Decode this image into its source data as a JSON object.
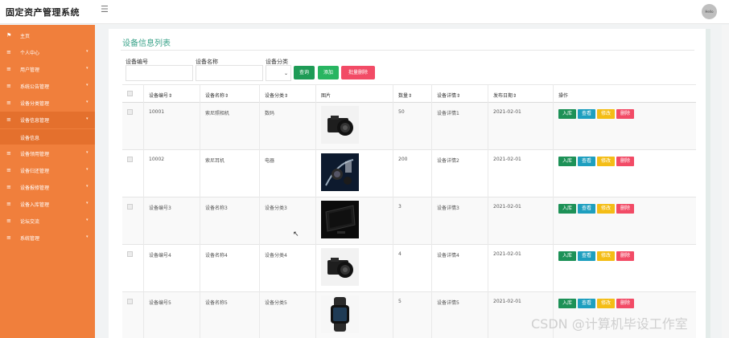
{
  "app": {
    "title": "固定资产管理系统",
    "avatar_text": "Hello"
  },
  "icons": {
    "menu_toggle": "hamburger-icon",
    "home": "flag-icon",
    "item": "list-icon",
    "caret": "caret-down-icon"
  },
  "colors": {
    "sidebar": "#f07f3c",
    "heading": "#3aa38a",
    "btn_query": "#1e9b56",
    "btn_add": "#28b561",
    "btn_batch_delete": "#f24b66",
    "btn_in": "#1d9157",
    "btn_view": "#1e9fbf",
    "btn_edit": "#f4bd16",
    "btn_delete": "#f24b66"
  },
  "sidebar": {
    "items": [
      {
        "label": "主页",
        "has_caret": false
      },
      {
        "label": "个人中心",
        "has_caret": true
      },
      {
        "label": "用户管理",
        "has_caret": true
      },
      {
        "label": "系统公告管理",
        "has_caret": true
      },
      {
        "label": "设备分类管理",
        "has_caret": true
      },
      {
        "label": "设备信息管理",
        "has_caret": true
      },
      {
        "label": "设备领用管理",
        "has_caret": true
      },
      {
        "label": "设备归还管理",
        "has_caret": true
      },
      {
        "label": "设备报修管理",
        "has_caret": true
      },
      {
        "label": "设备入库管理",
        "has_caret": true
      },
      {
        "label": "论坛交流",
        "has_caret": true
      },
      {
        "label": "系统管理",
        "has_caret": true
      }
    ],
    "sub_item": "设备信息"
  },
  "page": {
    "heading": "设备信息列表"
  },
  "search": {
    "code_label": "设备编号",
    "name_label": "设备名称",
    "category_label": "设备分类",
    "query_btn": "查询",
    "add_btn": "添加",
    "batch_delete_btn": "批量删除"
  },
  "table": {
    "headers": [
      "设备编号⇕",
      "设备名称⇕",
      "设备分类⇕",
      "图片",
      "数量⇕",
      "设备详情⇕",
      "发布日期⇕",
      "操作"
    ],
    "actions": [
      "入库",
      "查看",
      "修改",
      "删除"
    ],
    "rows": [
      {
        "code": "10001",
        "name": "索尼照相机",
        "category": "数码",
        "qty": "50",
        "detail": "设备详情1",
        "date": "2021-02-01",
        "image": "camera"
      },
      {
        "code": "10002",
        "name": "索尼耳机",
        "category": "电器",
        "qty": "200",
        "detail": "设备详情2",
        "date": "2021-02-01",
        "image": "earphones"
      },
      {
        "code": "设备编号3",
        "name": "设备名称3",
        "category": "设备分类3",
        "qty": "3",
        "detail": "设备详情3",
        "date": "2021-02-01",
        "image": "tv"
      },
      {
        "code": "设备编号4",
        "name": "设备名称4",
        "category": "设备分类4",
        "qty": "4",
        "detail": "设备详情4",
        "date": "2021-02-01",
        "image": "camera"
      },
      {
        "code": "设备编号5",
        "name": "设备名称5",
        "category": "设备分类5",
        "qty": "5",
        "detail": "设备详情5",
        "date": "2021-02-01",
        "image": "watch"
      }
    ]
  },
  "watermark": "CSDN @计算机毕设工作室"
}
